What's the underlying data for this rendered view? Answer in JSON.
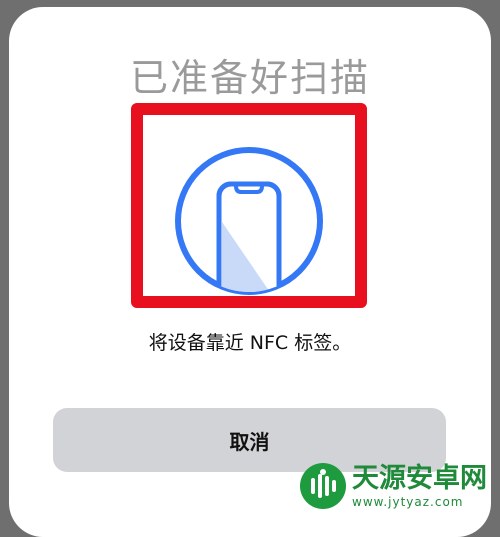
{
  "dialog": {
    "title": "已准备好扫描",
    "message": "将设备靠近 NFC 标签。",
    "cancel_label": "取消",
    "icon": "nfc-phone-icon"
  },
  "watermark": {
    "title": "天源安卓网",
    "url": "www.jytyaz.com"
  },
  "colors": {
    "accent": "#3478F6",
    "highlight": "#E8101E",
    "button_bg": "#D2D3D6",
    "title_text": "#9A9A9A",
    "watermark_green": "#1F8A3A"
  }
}
